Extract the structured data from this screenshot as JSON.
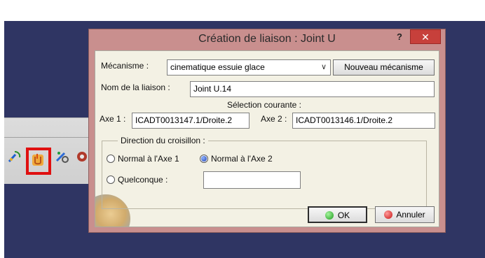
{
  "dialog": {
    "title": "Création de liaison : Joint U",
    "help_label": "?",
    "close_label": "✕",
    "mechanism_label": "Mécanisme :",
    "mechanism_value": "cinematique essuie glace",
    "new_mechanism_label": "Nouveau mécanisme",
    "joint_name_label": "Nom de la liaison :",
    "joint_name_value": "Joint U.14",
    "current_selection_label": "Sélection courante :",
    "axis1_label": "Axe 1 :",
    "axis1_value": "ICADT0013147.1/Droite.2",
    "axis2_label": "Axe 2 :",
    "axis2_value": "ICADT0013146.1/Droite.2",
    "group_title": "Direction du croisillon :",
    "options": [
      {
        "label": "Normal à l'Axe 1",
        "checked": false
      },
      {
        "label": "Normal à l'Axe 2",
        "checked": true
      },
      {
        "label": "Quelconque :",
        "checked": false
      }
    ],
    "other_value": "",
    "ok_label": "OK",
    "cancel_label": "Annuler"
  },
  "colors": {
    "desktop": "#2f3563",
    "dialog_frame": "#c98f8e",
    "close_button": "#c7403b",
    "highlight_box": "#e01010"
  },
  "toolbar": {
    "icons": [
      "wrench-curve-icon",
      "joint-u-icon",
      "tool-gear-icon",
      "gear-icon"
    ]
  }
}
